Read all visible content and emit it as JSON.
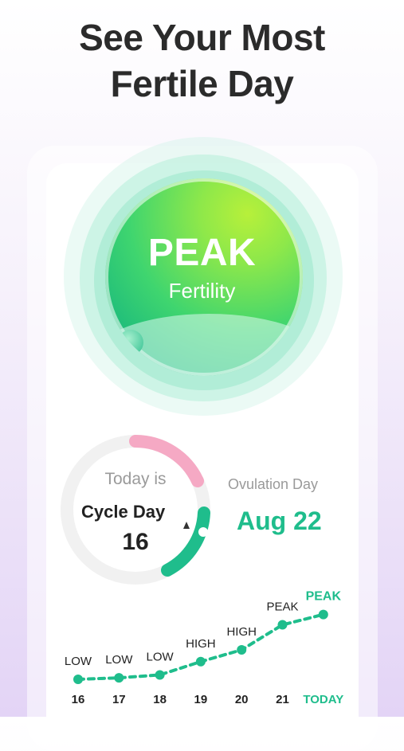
{
  "headline": {
    "line1": "See Your Most",
    "line2": "Fertile Day"
  },
  "fertility_status": {
    "level": "PEAK",
    "label": "Fertility"
  },
  "cycle": {
    "today_label": "Today is",
    "cycle_day_label": "Cycle Day",
    "cycle_day": "16"
  },
  "ovulation": {
    "label": "Ovulation Day",
    "date": "Aug 22"
  },
  "colors": {
    "accent_green": "#1fbd8c",
    "fertile_pink": "#f5a9c4",
    "text_dark": "#222222",
    "text_muted": "#9a9a9a"
  },
  "chart_data": {
    "type": "line",
    "categories": [
      "16",
      "17",
      "18",
      "19",
      "20",
      "21",
      "TODAY"
    ],
    "point_labels": [
      "LOW",
      "LOW",
      "LOW",
      "HIGH",
      "HIGH",
      "PEAK",
      "PEAK"
    ],
    "values": [
      1,
      1.1,
      1.3,
      2.2,
      3.0,
      4.7,
      5.4
    ],
    "highlight_index": 6
  }
}
